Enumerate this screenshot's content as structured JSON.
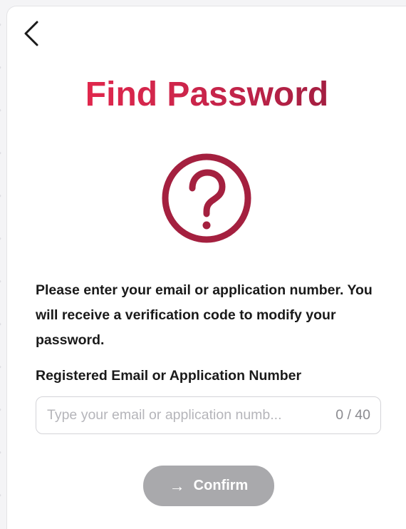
{
  "header": {
    "back_icon": "chevron-left-icon"
  },
  "main": {
    "title": "Find Password",
    "title_gradient": [
      "#f0294e",
      "#c4244a",
      "#8a1a3a"
    ],
    "help_icon": "question-circle-icon",
    "help_icon_color": "#a4203f",
    "description": "Please enter your email or application number. You will receive a verification code to modify your password."
  },
  "form": {
    "label": "Registered Email or Application Number",
    "input": {
      "value": "",
      "placeholder": "Type your email or application numb..."
    },
    "char_count": "0 / 40",
    "confirm": {
      "label": "Confirm",
      "icon": "arrow-right-icon",
      "icon_glyph": "→",
      "state": "disabled",
      "color": "#a9a9ac"
    }
  }
}
